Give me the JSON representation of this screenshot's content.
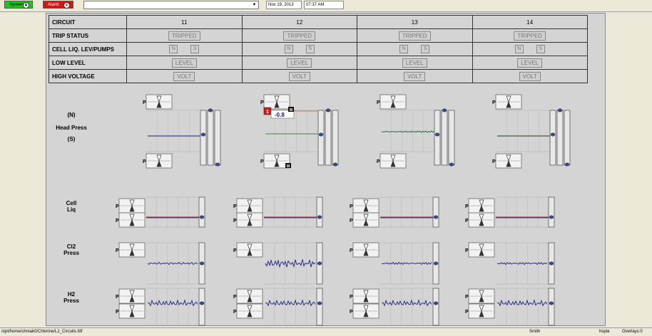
{
  "toolbar": {
    "system_label": "System",
    "alarm_label": "Alarm",
    "date": "Nov 19, 2013",
    "time": "07:37 AM",
    "colors": {
      "system": "#22c322",
      "alarm": "#d01818"
    }
  },
  "table": {
    "header_label": "CIRCUIT",
    "circuits": [
      "11",
      "12",
      "13",
      "14"
    ],
    "rows": [
      {
        "label": "TRIP STATUS",
        "value": "TRIPPED"
      },
      {
        "label": "CELL LIQ. LEV/PUMPS",
        "n": "N",
        "s": "S"
      },
      {
        "label": "LOW LEVEL",
        "value": "LEVEL"
      },
      {
        "label": "HIGH VOLTAGE",
        "value": "VOLT"
      }
    ]
  },
  "labels": {
    "n": "(N)",
    "head_press": "Head Press",
    "s": "(S)",
    "cell": "Cell",
    "liq": "Liq",
    "cl2": "Cl2",
    "press": "Press",
    "h2": "H2"
  },
  "p_label": "P",
  "circuit12_alarm": {
    "badge": "1",
    "value": "-0.8",
    "m": "M"
  },
  "status_bar": {
    "path": "/opt/home/chmak0/Chlorine/L1_Circuits.fdf",
    "user": "Smith",
    "host": "hspla",
    "overlays": "Overlays:0"
  }
}
